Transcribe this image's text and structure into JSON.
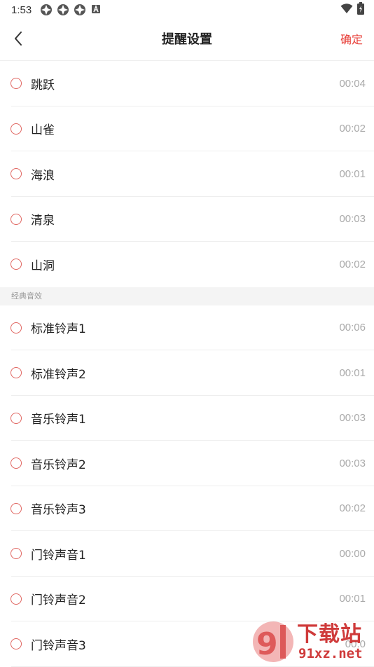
{
  "status_bar": {
    "time": "1:53",
    "notification_icons": [
      "app-notification-icon",
      "app-notification-icon",
      "app-notification-icon",
      "font-a-icon"
    ],
    "right_icons": [
      "wifi-icon",
      "battery-icon"
    ]
  },
  "header": {
    "back_icon": "back-arrow-icon",
    "title": "提醒设置",
    "confirm_label": "确定"
  },
  "sounds": [
    {
      "label": "跳跃",
      "duration": "00:04"
    },
    {
      "label": "山雀",
      "duration": "00:02"
    },
    {
      "label": "海浪",
      "duration": "00:01"
    },
    {
      "label": "清泉",
      "duration": "00:03"
    },
    {
      "label": "山洞",
      "duration": "00:02"
    }
  ],
  "classic_section": {
    "title": "经典音效",
    "items": [
      {
        "label": "标准铃声1",
        "duration": "00:06"
      },
      {
        "label": "标准铃声2",
        "duration": "00:01"
      },
      {
        "label": "音乐铃声1",
        "duration": "00:03"
      },
      {
        "label": "音乐铃声2",
        "duration": "00:03"
      },
      {
        "label": "音乐铃声3",
        "duration": "00:02"
      },
      {
        "label": "门铃声音1",
        "duration": "00:00"
      },
      {
        "label": "门铃声音2",
        "duration": "00:01"
      },
      {
        "label": "门铃声音3",
        "duration": "00:0"
      }
    ]
  },
  "watermark": {
    "title": "下载站",
    "url": "91xz.net"
  },
  "colors": {
    "accent": "#e8413b",
    "radio_border": "#e06661",
    "duration_text": "#aaaaaa",
    "section_bg": "#f4f4f4"
  }
}
